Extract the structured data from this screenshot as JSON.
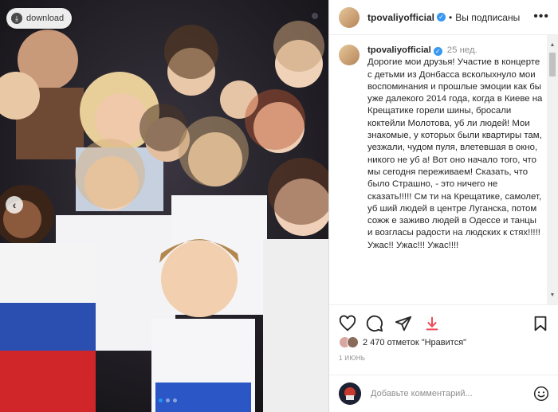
{
  "photo": {
    "download_label": "download",
    "carousel_dots": 4,
    "active_dot": 1
  },
  "post": {
    "username": "tpovaliyofficial",
    "separator": "•",
    "following_label": "Вы подписаны",
    "time_ago": "25 нед.",
    "caption": "Дорогие мои друзья! Участие в концерте с детьми из Донбасса всколыхнуло мои воспоминания и прошлые эмоции как бы уже далекого 2014 года, когда в Киеве на Крещатике горели шины, бросали коктейли Молотова, уб  ли людей! Мои знакомые, у которых были квартиры там, уезжали, чудом пуля, влетевшая в окно, никого не уб  а! Вот оно начало того, что мы сегодня переживаем! Сказать, что было Страшно, - это ничего не сказать!!!!! См  ти на Крещатике, самолет, уб  ший людей в центре Луганска, потом сожж  е заживо людей в Одессе и танцы и возгласы радости на людских к  стях!!!!! Ужас!! Ужас!!! Ужас!!!!",
    "likes_text": "2 470 отметок \"Нравится\"",
    "date": "1 ИЮНЬ"
  },
  "comment": {
    "placeholder": "Добавьте комментарий..."
  },
  "icons": [
    "more-icon",
    "heart-icon",
    "comment-icon",
    "share-icon",
    "bookmark-icon",
    "emoji-icon",
    "download-icon",
    "chevron-left-icon"
  ],
  "colors": {
    "verified": "#3897f0",
    "active_dot": "#2196f3",
    "save_red": "#ed4956"
  }
}
